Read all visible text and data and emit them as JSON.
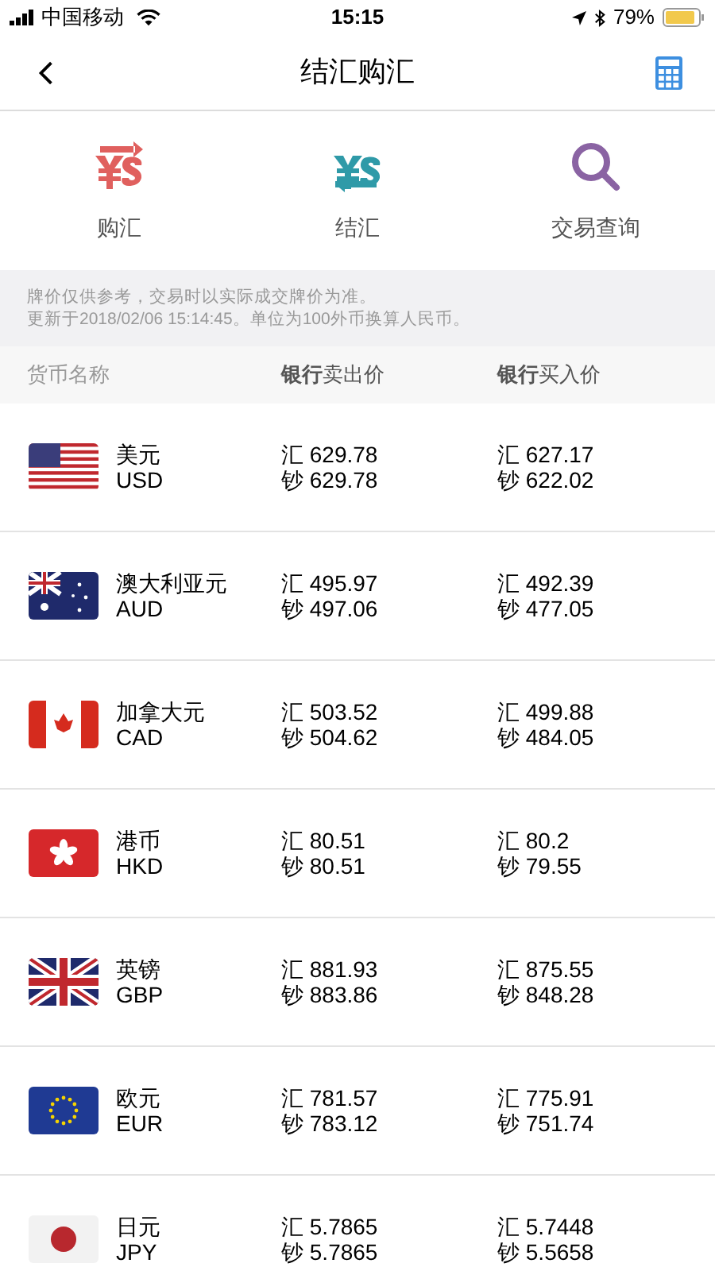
{
  "status_bar": {
    "carrier": "中国移动",
    "time": "15:15",
    "battery": "79%"
  },
  "nav": {
    "title": "结汇购汇"
  },
  "shortcuts": [
    {
      "label": "购汇",
      "color": "#e0605e"
    },
    {
      "label": "结汇",
      "color": "#2f9aa8"
    },
    {
      "label": "交易查询",
      "color": "#8a63a3"
    }
  ],
  "notice": [
    "牌价仅供参考，交易时以实际成交牌价为准。",
    "更新于2018/02/06 15:14:45。单位为100外币换算人民币。"
  ],
  "table": {
    "columns": [
      "货币名称",
      "**银行**卖出价",
      "**银行**买入价"
    ],
    "rows": [
      {
        "name": "美元",
        "code": "USD",
        "sell": [
          "汇 629.78",
          "钞 629.78"
        ],
        "buy": [
          "汇 627.17",
          "钞 622.02"
        ]
      },
      {
        "name": "澳大利亚元",
        "code": "AUD",
        "sell": [
          "汇 495.97",
          "钞 497.06"
        ],
        "buy": [
          "汇 492.39",
          "钞 477.05"
        ]
      },
      {
        "name": "加拿大元",
        "code": "CAD",
        "sell": [
          "汇 503.52",
          "钞 504.62"
        ],
        "buy": [
          "汇 499.88",
          "钞 484.05"
        ]
      },
      {
        "name": "港币",
        "code": "HKD",
        "sell": [
          "汇 80.51",
          "钞 80.51"
        ],
        "buy": [
          "汇 80.2",
          "钞 79.55"
        ]
      },
      {
        "name": "英镑",
        "code": "GBP",
        "sell": [
          "汇 881.93",
          "钞 883.86"
        ],
        "buy": [
          "汇 875.55",
          "钞 848.28"
        ]
      },
      {
        "name": "欧元",
        "code": "EUR",
        "sell": [
          "汇 781.57",
          "钞 783.12"
        ],
        "buy": [
          "汇 775.91",
          "钞 751.74"
        ]
      },
      {
        "name": "日元",
        "code": "JPY",
        "sell": [
          "汇 5.7865",
          "钞 5.7865"
        ],
        "buy": [
          "汇 5.7448",
          "钞 5.5658"
        ]
      }
    ]
  }
}
